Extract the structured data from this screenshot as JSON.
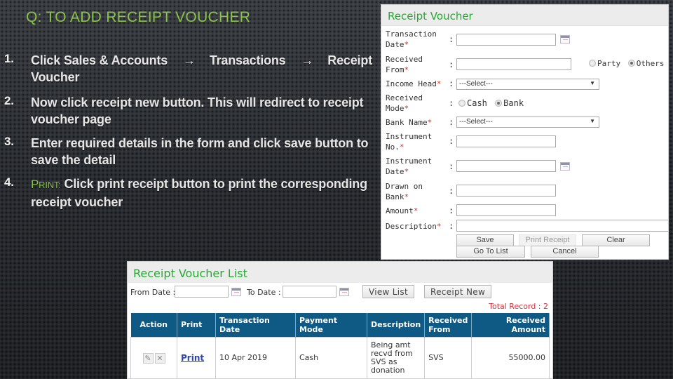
{
  "slide": {
    "title": "Q: TO ADD RECEIPT VOUCHER",
    "steps": [
      {
        "num": "1.",
        "parts": [
          "Click  Sales & Accounts",
          "Transactions",
          "Receipt",
          "Voucher"
        ],
        "separator": "→"
      },
      {
        "num": "2.",
        "text": "Now click receipt new button.  This will redirect to receipt voucher page"
      },
      {
        "num": "3.",
        "text": "Enter required details in the form and click save button to save the detail"
      },
      {
        "num": "4.",
        "accent_first": "P",
        "accent_rest": "RINT:",
        "text": " Click print receipt button to print the corresponding receipt voucher"
      }
    ],
    "accent_color": "#8bc34a"
  },
  "receipt_voucher_form": {
    "title": "Receipt Voucher",
    "fields": {
      "transaction_date": {
        "label_line1": "Transaction",
        "label_line2": "Date",
        "required": "*",
        "value": ""
      },
      "received_from": {
        "label_line1": "Received",
        "label_line2": "From",
        "required": "*",
        "value": "",
        "options": [
          {
            "label": "Party",
            "checked": false
          },
          {
            "label": "Others",
            "checked": true
          }
        ]
      },
      "income_head": {
        "label": "Income Head",
        "required": "*",
        "selected": "---Select---"
      },
      "received_mode": {
        "label_line1": "Received",
        "label_line2": "Mode",
        "required": "*",
        "options": [
          {
            "label": "Cash",
            "checked": false
          },
          {
            "label": "Bank",
            "checked": true
          }
        ]
      },
      "bank_name": {
        "label": "Bank Name",
        "required": "*",
        "selected": "---Select---"
      },
      "instrument_no": {
        "label_line1": "Instrument",
        "label_line2": "No.",
        "required": "*",
        "value": ""
      },
      "instrument_date": {
        "label_line1": "Instrument",
        "label_line2": "Date",
        "required": "*",
        "value": ""
      },
      "drawn_on_bank": {
        "label_line1": "Drawn on",
        "label_line2": "Bank",
        "required": "*",
        "value": ""
      },
      "amount": {
        "label": "Amount",
        "required": "*",
        "value": ""
      },
      "description": {
        "label": "Description",
        "required": "*",
        "value": ""
      }
    },
    "colon": ":",
    "buttons": {
      "save": "Save",
      "print_receipt": "Print Receipt",
      "clear": "Clear",
      "go_to_list": "Go To List",
      "cancel": "Cancel"
    },
    "title_color": "#27a833",
    "required_color": "#c0392b"
  },
  "receipt_voucher_list": {
    "title": "Receipt Voucher List",
    "filters": {
      "from_date_label": "From Date :",
      "from_date_value": "",
      "to_date_label": "To Date :",
      "to_date_value": ""
    },
    "buttons": {
      "view_list": "View List",
      "receipt_new": "Receipt New"
    },
    "total_record": "Total Record : 2",
    "columns": [
      "Action",
      "Print",
      "Transaction Date",
      "Payment Mode",
      "Description",
      "Received From",
      "Received Amount"
    ],
    "rows": [
      {
        "print_link": "Print",
        "transaction_date": "10 Apr 2019",
        "payment_mode": "Cash",
        "description": "Being amt recvd from SVS as donation",
        "received_from": "SVS",
        "received_amount": "55000.00"
      }
    ],
    "header_color": "#0e5a85",
    "total_color": "#d6303b"
  }
}
